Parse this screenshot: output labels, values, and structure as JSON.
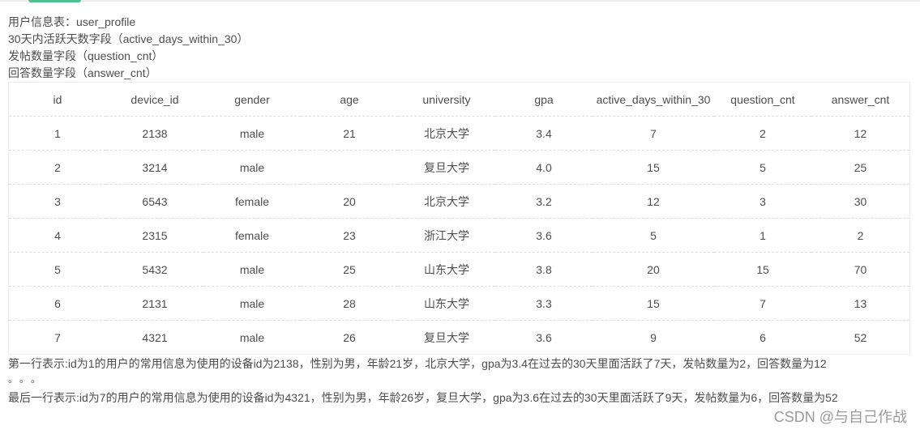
{
  "intro": {
    "line1": "用户信息表：user_profile",
    "line2": "30天内活跃天数字段（active_days_within_30）",
    "line3": "发帖数量字段（question_cnt）",
    "line4": "回答数量字段（answer_cnt）"
  },
  "table": {
    "headers": [
      "id",
      "device_id",
      "gender",
      "age",
      "university",
      "gpa",
      "active_days_within_30",
      "question_cnt",
      "answer_cnt"
    ],
    "rows": [
      [
        "1",
        "2138",
        "male",
        "21",
        "北京大学",
        "3.4",
        "7",
        "2",
        "12"
      ],
      [
        "2",
        "3214",
        "male",
        "",
        "复旦大学",
        "4.0",
        "15",
        "5",
        "25"
      ],
      [
        "3",
        "6543",
        "female",
        "20",
        "北京大学",
        "3.2",
        "12",
        "3",
        "30"
      ],
      [
        "4",
        "2315",
        "female",
        "23",
        "浙江大学",
        "3.6",
        "5",
        "1",
        "2"
      ],
      [
        "5",
        "5432",
        "male",
        "25",
        "山东大学",
        "3.8",
        "20",
        "15",
        "70"
      ],
      [
        "6",
        "2131",
        "male",
        "28",
        "山东大学",
        "3.3",
        "15",
        "7",
        "13"
      ],
      [
        "7",
        "4321",
        "male",
        "26",
        "复旦大学",
        "3.6",
        "9",
        "6",
        "52"
      ]
    ]
  },
  "footer": {
    "line1": "第一行表示:id为1的用户的常用信息为使用的设备id为2138，性别为男，年龄21岁，北京大学，gpa为3.4在过去的30天里面活跃了7天，发帖数量为2，回答数量为12",
    "ellipsis": "。。。",
    "line3": "最后一行表示:id为7的用户的常用信息为使用的设备id为4321，性别为男，年龄26岁，复旦大学，gpa为3.6在过去的30天里面活跃了9天，发帖数量为6，回答数量为52"
  },
  "watermark": "CSDN @与自己作战"
}
